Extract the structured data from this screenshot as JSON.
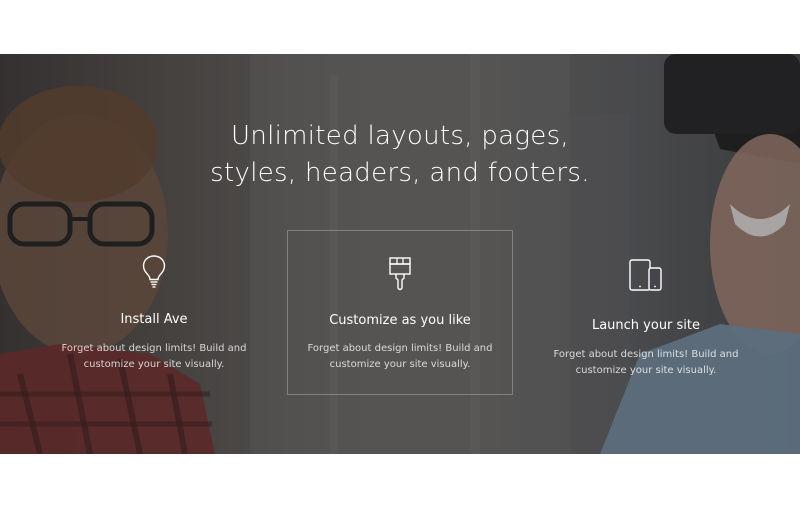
{
  "hero": {
    "headline_line1": "Unlimited layouts, pages,",
    "headline_line2": "styles, headers, and footers."
  },
  "features": [
    {
      "icon": "lightbulb-icon",
      "title": "Install Ave",
      "desc_line1": "Forget about design limits! Build and",
      "desc_line2": "customize your site visually."
    },
    {
      "icon": "paintbrush-icon",
      "title": "Customize as you like",
      "desc_line1": "Forget about design limits! Build and",
      "desc_line2": "customize your site visually."
    },
    {
      "icon": "devices-icon",
      "title": "Launch your site",
      "desc_line1": "Forget about design limits! Build and",
      "desc_line2": "customize your site visually."
    }
  ],
  "colors": {
    "overlay": "#2a2525",
    "text": "#ffffff",
    "page_background": "#ffffff"
  }
}
